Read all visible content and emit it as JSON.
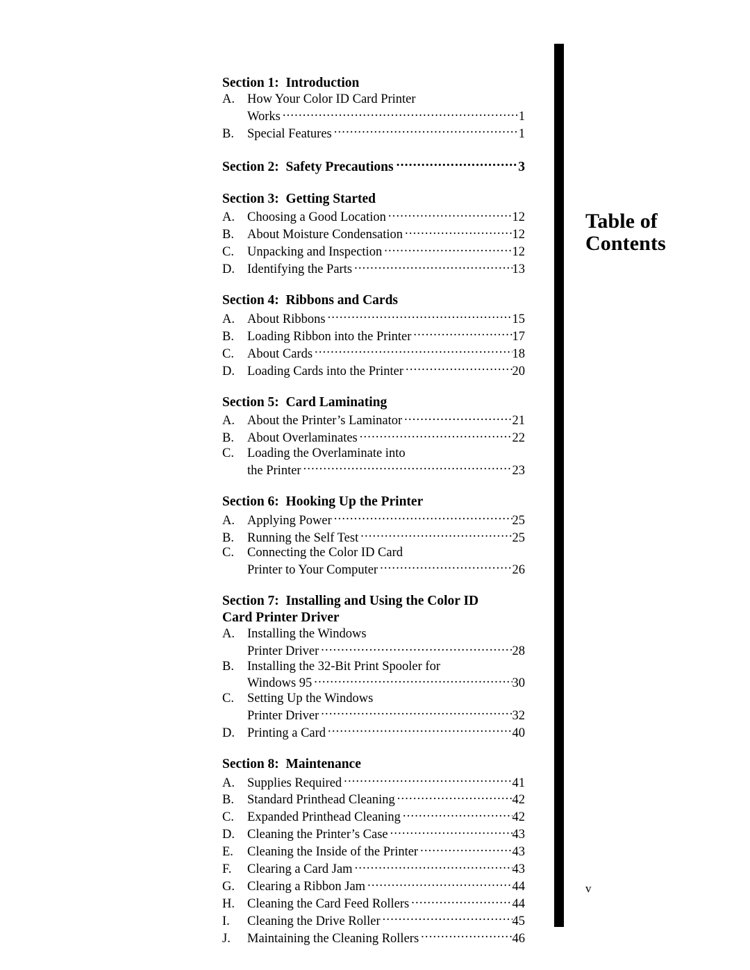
{
  "document": {
    "title_line_1": "Table of",
    "title_line_2": "Contents",
    "folio": "v"
  },
  "toc": {
    "sections": [
      {
        "heading": "Section 1:  Introduction",
        "page": "",
        "entries": [
          {
            "marker": "A.",
            "lines": [
              "How Your Color ID Card Printer",
              "Works"
            ],
            "page": "1"
          },
          {
            "marker": "B.",
            "lines": [
              "Special Features"
            ],
            "page": "1"
          }
        ]
      },
      {
        "heading": "Section 2:  Safety Precautions",
        "page": "3",
        "entries": []
      },
      {
        "heading": "Section 3:  Getting Started",
        "page": "",
        "entries": [
          {
            "marker": "A.",
            "lines": [
              "Choosing a Good Location"
            ],
            "page": "12"
          },
          {
            "marker": "B.",
            "lines": [
              "About Moisture Condensation"
            ],
            "page": "12"
          },
          {
            "marker": "C.",
            "lines": [
              "Unpacking and Inspection"
            ],
            "page": "12"
          },
          {
            "marker": "D.",
            "lines": [
              "Identifying the Parts"
            ],
            "page": "13"
          }
        ]
      },
      {
        "heading": "Section 4:  Ribbons and Cards",
        "page": "",
        "entries": [
          {
            "marker": "A.",
            "lines": [
              "About Ribbons"
            ],
            "page": "15"
          },
          {
            "marker": "B.",
            "lines": [
              "Loading Ribbon into the Printer"
            ],
            "page": "17"
          },
          {
            "marker": "C.",
            "lines": [
              "About Cards"
            ],
            "page": "18"
          },
          {
            "marker": "D.",
            "lines": [
              "Loading Cards into the Printer"
            ],
            "page": "20"
          }
        ]
      },
      {
        "heading": "Section 5:  Card Laminating",
        "page": "",
        "entries": [
          {
            "marker": "A.",
            "lines": [
              "About the Printer’s Laminator"
            ],
            "page": "21"
          },
          {
            "marker": "B.",
            "lines": [
              "About Overlaminates"
            ],
            "page": "22"
          },
          {
            "marker": "C.",
            "lines": [
              "Loading the Overlaminate into",
              "the Printer"
            ],
            "page": "23"
          }
        ]
      },
      {
        "heading": "Section 6:  Hooking Up the Printer",
        "page": "",
        "entries": [
          {
            "marker": "A.",
            "lines": [
              "Applying Power"
            ],
            "page": "25"
          },
          {
            "marker": "B.",
            "lines": [
              "Running the Self Test"
            ],
            "page": "25"
          },
          {
            "marker": "C.",
            "lines": [
              "Connecting the Color ID Card",
              "Printer to Your Computer"
            ],
            "page": "26"
          }
        ]
      },
      {
        "heading": "Section 7:  Installing and Using the Color ID\nCard Printer Driver",
        "page": "",
        "entries": [
          {
            "marker": "A.",
            "lines": [
              "Installing the Windows",
              "Printer Driver"
            ],
            "page": "28"
          },
          {
            "marker": "B.",
            "lines": [
              "Installing the 32-Bit Print Spooler for",
              "Windows 95"
            ],
            "page": "30"
          },
          {
            "marker": "C.",
            "lines": [
              "Setting Up the Windows",
              "Printer Driver"
            ],
            "page": "32"
          },
          {
            "marker": "D.",
            "lines": [
              "Printing a Card"
            ],
            "page": "40"
          }
        ]
      },
      {
        "heading": "Section 8:  Maintenance",
        "page": "",
        "entries": [
          {
            "marker": "A.",
            "lines": [
              "Supplies Required"
            ],
            "page": "41"
          },
          {
            "marker": "B.",
            "lines": [
              "Standard Printhead Cleaning"
            ],
            "page": "42"
          },
          {
            "marker": "C.",
            "lines": [
              "Expanded Printhead Cleaning"
            ],
            "page": "42"
          },
          {
            "marker": "D.",
            "lines": [
              "Cleaning the Printer’s Case"
            ],
            "page": "43"
          },
          {
            "marker": "E.",
            "lines": [
              "Cleaning the Inside of the Printer"
            ],
            "page": "43"
          },
          {
            "marker": "F.",
            "lines": [
              "Clearing a Card Jam"
            ],
            "page": "43"
          },
          {
            "marker": "G.",
            "lines": [
              "Clearing a Ribbon Jam"
            ],
            "page": "44"
          },
          {
            "marker": "H.",
            "lines": [
              "Cleaning the Card Feed Rollers"
            ],
            "page": "44"
          },
          {
            "marker": "I.",
            "lines": [
              "Cleaning the Drive Roller"
            ],
            "page": "45"
          },
          {
            "marker": "J.",
            "lines": [
              "Maintaining the Cleaning Rollers"
            ],
            "page": "46"
          }
        ]
      }
    ]
  }
}
